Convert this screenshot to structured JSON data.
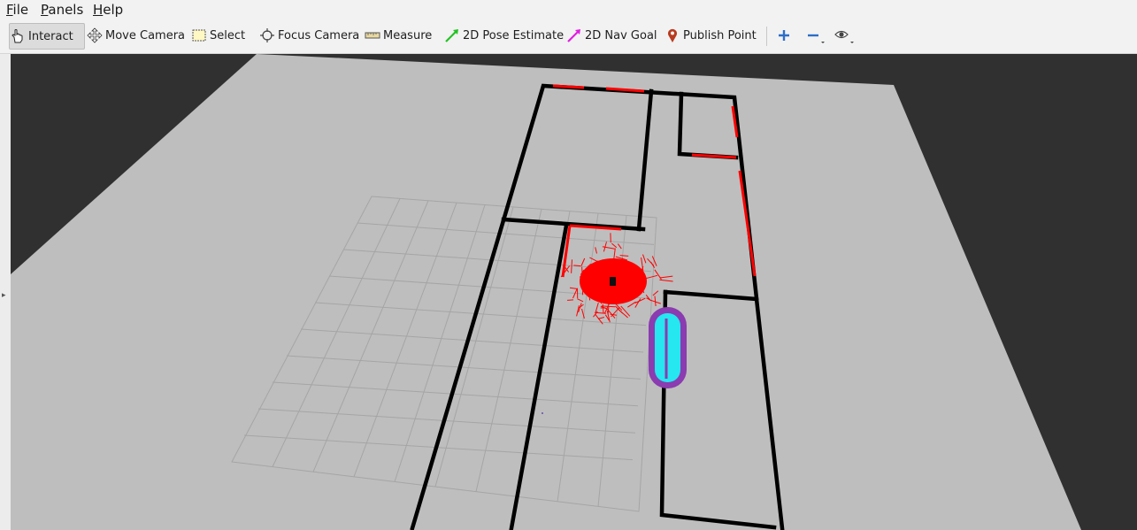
{
  "menu": {
    "file": {
      "mnemonic": "F",
      "rest": "ile"
    },
    "panels": {
      "mnemonic": "P",
      "rest": "anels"
    },
    "help": {
      "mnemonic": "H",
      "rest": "elp"
    }
  },
  "toolbar": {
    "tools": [
      {
        "label": "Interact",
        "icon": "hand-pointer-icon",
        "active": true
      },
      {
        "label": "Move Camera",
        "icon": "move-camera-icon"
      },
      {
        "label": "Select",
        "icon": "select-box-icon"
      },
      {
        "label": "Focus Camera",
        "icon": "focus-camera-icon"
      },
      {
        "label": "Measure",
        "icon": "ruler-icon"
      },
      {
        "label": "2D Pose Estimate",
        "icon": "green-arrow-icon"
      },
      {
        "label": "2D Nav Goal",
        "icon": "magenta-arrow-icon"
      },
      {
        "label": "Publish Point",
        "icon": "map-pin-icon"
      }
    ],
    "extra_icons": [
      "plus-icon",
      "minus-icon",
      "eye-icon"
    ]
  },
  "colors": {
    "background": "#303030",
    "floor": "#bebebe",
    "walls": "#000000",
    "laser": "#ff0000",
    "grid": "#a5a5a5",
    "costmap_inner": "#26e6f0",
    "costmap_outer": "#8a3cb0"
  }
}
